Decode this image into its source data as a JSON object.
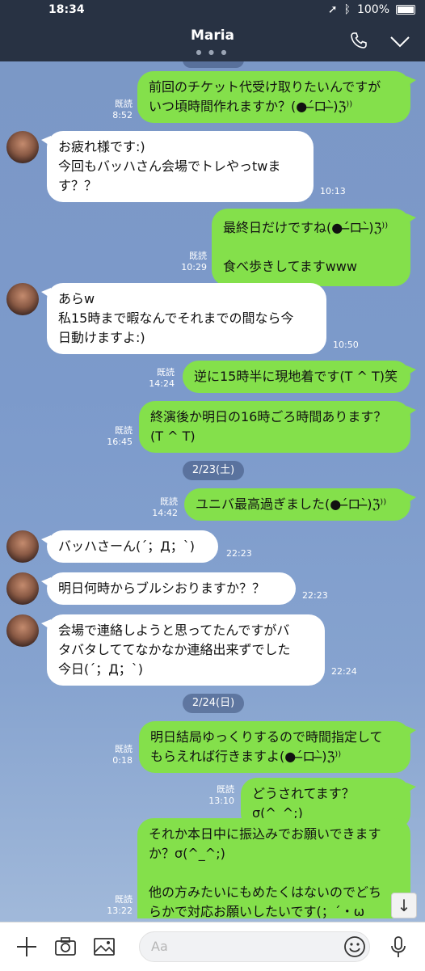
{
  "status": {
    "time": "18:34",
    "battery": "100%"
  },
  "header": {
    "title": "Maria",
    "page_dots": "● ● ●"
  },
  "messages": {
    "m1": {
      "text": "前回のチケット代受け取りたいんですが\nいつ頃時間作れますか？(●ˊ̶ロˋ̶)ℨ⁾⁾",
      "read": "既読",
      "time": "8:52"
    },
    "m2": {
      "text": "お疲れ様です:)\n今回もバッハさん会場でトレやっtwま\nす？？",
      "time": "10:13"
    },
    "m3": {
      "text": "最終日だけですね(●ˊ̶ロˋ̶)ℨ⁾⁾\n\n食べ歩きしてますwww",
      "read": "既読",
      "time": "10:29"
    },
    "m4": {
      "text": "あらw\n私15時まで暇なんでそれまでの間なら今\n日動けますよ:)",
      "time": "10:50"
    },
    "m5": {
      "text": "逆に15時半に現地着です(T ^ T)笑",
      "read": "既読",
      "time": "14:24"
    },
    "m6": {
      "text": "終演後か明日の16時ごろ時間あります？\n(T ^ T)",
      "read": "既読",
      "time": "16:45"
    },
    "m7": {
      "text": "ユニバ最高過ぎました(●ˊ̶ロˋ̶)ℨ⁾⁾",
      "read": "既読",
      "time": "14:42"
    },
    "m8": {
      "text": "バッハさーん(´；Д；`)",
      "time": "22:23"
    },
    "m9": {
      "text": "明日何時からブルシおりますか？？",
      "time": "22:23"
    },
    "m10": {
      "text": "会場で連絡しようと思ってたんですがバ\nタバタしててなかなか連絡出来ずでした\n今日(´；Д；`)",
      "time": "22:24"
    },
    "m11": {
      "text": "明日結局ゆっくりするので時間指定して\nもらえれば行きますよ(●ˊ̶ロˋ̶)ℨ⁾⁾",
      "read": "既読",
      "time": "0:18"
    },
    "m12": {
      "text": "どうされてます？σ(^_^;)",
      "read": "既読",
      "time": "13:10"
    },
    "m13": {
      "text": "それか本日中に振込みでお願いできます\nか？σ(^_^;)\n\n他の方みたいにもめたくはないのでどち\nらかで対応お願いしたいです(；´・ω",
      "read": "既読",
      "time": "13:22"
    }
  },
  "dates": {
    "d1": "2/23(土)",
    "d2": "2/24(日)"
  },
  "input": {
    "placeholder": "Aa"
  },
  "icons": {
    "plus": "plus-icon",
    "camera": "camera-icon",
    "image": "image-icon",
    "emoji": "emoji-icon",
    "mic": "microphone-icon",
    "phone": "phone-icon",
    "chevron": "chevron-down-icon",
    "scroll": "arrow-down-icon"
  },
  "colors": {
    "header": "#283243",
    "outgoing": "#84e04b",
    "incoming": "#ffffff",
    "background": "#7c9acb"
  }
}
